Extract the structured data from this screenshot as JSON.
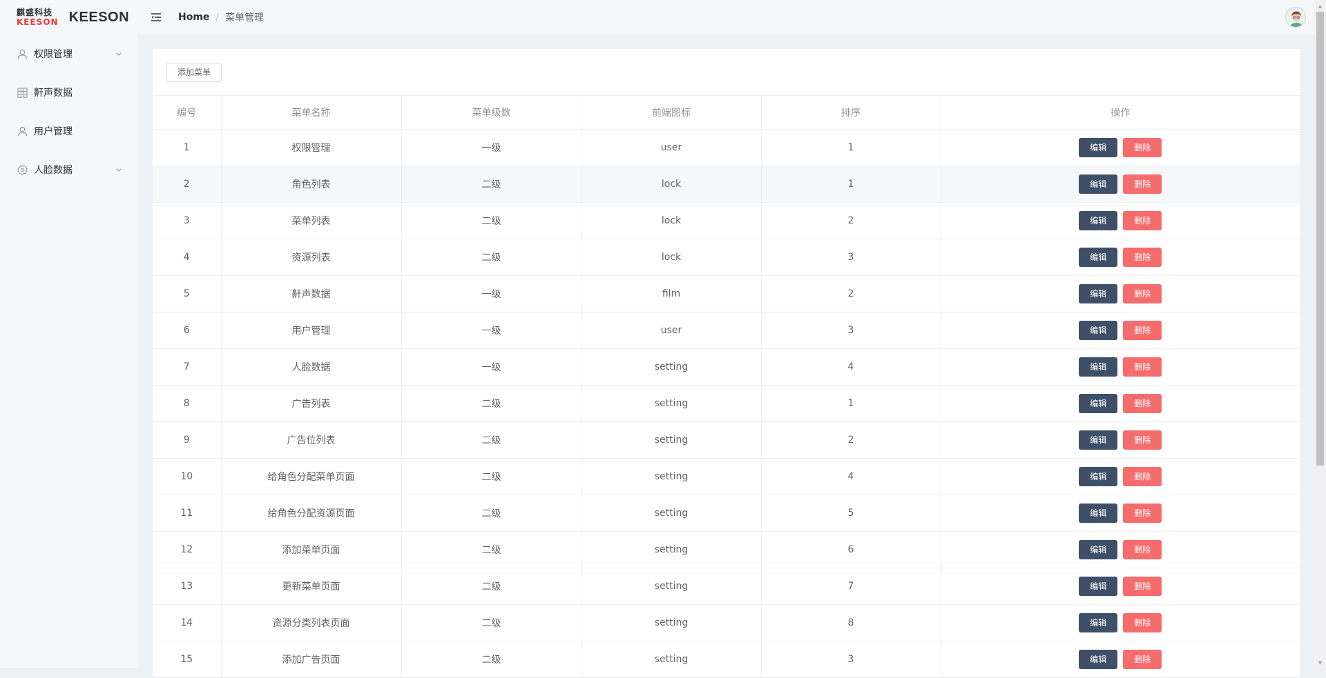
{
  "logo": {
    "cn": "麒盛科技",
    "en": "KEESON",
    "text": "KEESON"
  },
  "sidebar": {
    "items": [
      {
        "label": "权限管理",
        "icon": "user-icon",
        "expandable": true
      },
      {
        "label": "鼾声数据",
        "icon": "grid-icon",
        "expandable": false
      },
      {
        "label": "用户管理",
        "icon": "user-icon",
        "expandable": false
      },
      {
        "label": "人脸数据",
        "icon": "gear-icon",
        "expandable": true
      }
    ]
  },
  "header": {
    "breadcrumb": {
      "home": "Home",
      "separator": "/",
      "current": "菜单管理"
    }
  },
  "toolbar": {
    "add_label": "添加菜单"
  },
  "table": {
    "headers": [
      "编号",
      "菜单名称",
      "菜单级数",
      "前端图标",
      "排序",
      "操作"
    ],
    "edit_label": "编辑",
    "delete_label": "删除",
    "rows": [
      {
        "id": "1",
        "name": "权限管理",
        "level": "一级",
        "icon": "user",
        "sort": "1"
      },
      {
        "id": "2",
        "name": "角色列表",
        "level": "二级",
        "icon": "lock",
        "sort": "1"
      },
      {
        "id": "3",
        "name": "菜单列表",
        "level": "二级",
        "icon": "lock",
        "sort": "2"
      },
      {
        "id": "4",
        "name": "资源列表",
        "level": "二级",
        "icon": "lock",
        "sort": "3"
      },
      {
        "id": "5",
        "name": "鼾声数据",
        "level": "一级",
        "icon": "film",
        "sort": "2"
      },
      {
        "id": "6",
        "name": "用户管理",
        "level": "一级",
        "icon": "user",
        "sort": "3"
      },
      {
        "id": "7",
        "name": "人脸数据",
        "level": "一级",
        "icon": "setting",
        "sort": "4"
      },
      {
        "id": "8",
        "name": "广告列表",
        "level": "二级",
        "icon": "setting",
        "sort": "1"
      },
      {
        "id": "9",
        "name": "广告位列表",
        "level": "二级",
        "icon": "setting",
        "sort": "2"
      },
      {
        "id": "10",
        "name": "给角色分配菜单页面",
        "level": "二级",
        "icon": "setting",
        "sort": "4"
      },
      {
        "id": "11",
        "name": "给角色分配资源页面",
        "level": "二级",
        "icon": "setting",
        "sort": "5"
      },
      {
        "id": "12",
        "name": "添加菜单页面",
        "level": "二级",
        "icon": "setting",
        "sort": "6"
      },
      {
        "id": "13",
        "name": "更新菜单页面",
        "level": "二级",
        "icon": "setting",
        "sort": "7"
      },
      {
        "id": "14",
        "name": "资源分类列表页面",
        "level": "二级",
        "icon": "setting",
        "sort": "8"
      },
      {
        "id": "15",
        "name": "添加广告页面",
        "level": "二级",
        "icon": "setting",
        "sort": "3"
      }
    ]
  },
  "colors": {
    "edit_button": "#3e5068",
    "delete_button": "#f56c6c",
    "logo_red": "#e33a3a"
  }
}
